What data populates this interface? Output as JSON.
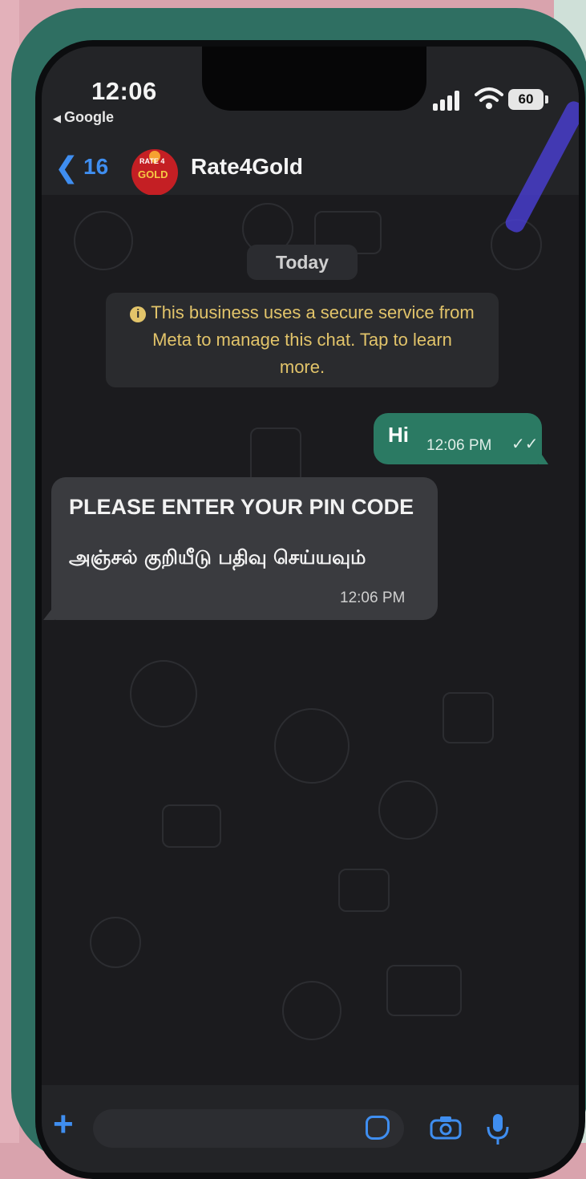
{
  "status_bar": {
    "time": "12:06",
    "back_app": "Google",
    "battery": "60"
  },
  "header": {
    "back_count": "16",
    "contact_name": "Rate4Gold",
    "avatar_text_top": "RATE 4",
    "avatar_text_bottom": "GOLD"
  },
  "chat": {
    "date_label": "Today",
    "notice": "This business uses a secure service from Meta to manage this chat. Tap to learn more.",
    "messages": [
      {
        "direction": "outgoing",
        "text": "Hi",
        "time": "12:06 PM",
        "status": "read"
      },
      {
        "direction": "incoming",
        "text": "PLEASE ENTER YOUR PIN CODE",
        "text_secondary": "அஞ்சல் குறியீடு பதிவு செய்யவும்",
        "time": "12:06 PM"
      }
    ]
  },
  "composer": {
    "placeholder": ""
  },
  "colors": {
    "accent": "#3f8ef0",
    "outgoing_bubble": "#2b7a63",
    "incoming_bubble": "#3a3b3f",
    "notice_text": "#e2c46a",
    "case": "#2f6f62"
  }
}
